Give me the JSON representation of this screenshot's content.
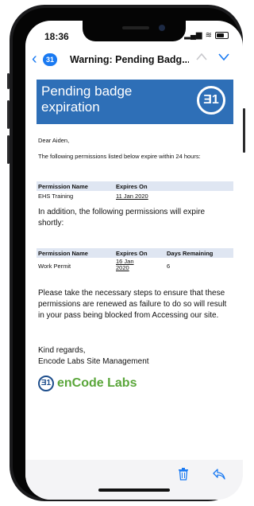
{
  "status": {
    "time": "18:36"
  },
  "nav": {
    "unread_count": "31",
    "subject": "Warning: Pending Badg..."
  },
  "email": {
    "banner_title": "Pending badge expiration",
    "greeting": "Dear Aiden,",
    "intro": "The following permissions listed below expire within 24 hours:",
    "table1": {
      "headers": [
        "Permission Name",
        "Expires On"
      ],
      "rows": [
        [
          "EHS Training",
          "11 Jan 2020"
        ]
      ]
    },
    "addition_text": "In addition, the following permissions will expire shortly:",
    "table2": {
      "headers": [
        "Permission Name",
        "Expires On",
        "Days Remaining"
      ],
      "rows": [
        [
          "Work Permit",
          "16 Jan 2020",
          "6"
        ]
      ]
    },
    "closing": "Please take the necessary steps to ensure that these permissions are renewed as failure to do so will result in your pass being blocked from Accessing our site.",
    "regards": "Kind regards,",
    "signature": "Encode Labs Site Management",
    "brand_name": "enCode Labs"
  },
  "colors": {
    "accent": "#1a7af2",
    "banner": "#2e6fb7",
    "brand_green": "#5aa63a",
    "table_header": "#dfe6f2"
  },
  "icons": {
    "back": "chevron-left-icon",
    "trash": "trash-icon",
    "reply": "reply-icon"
  }
}
